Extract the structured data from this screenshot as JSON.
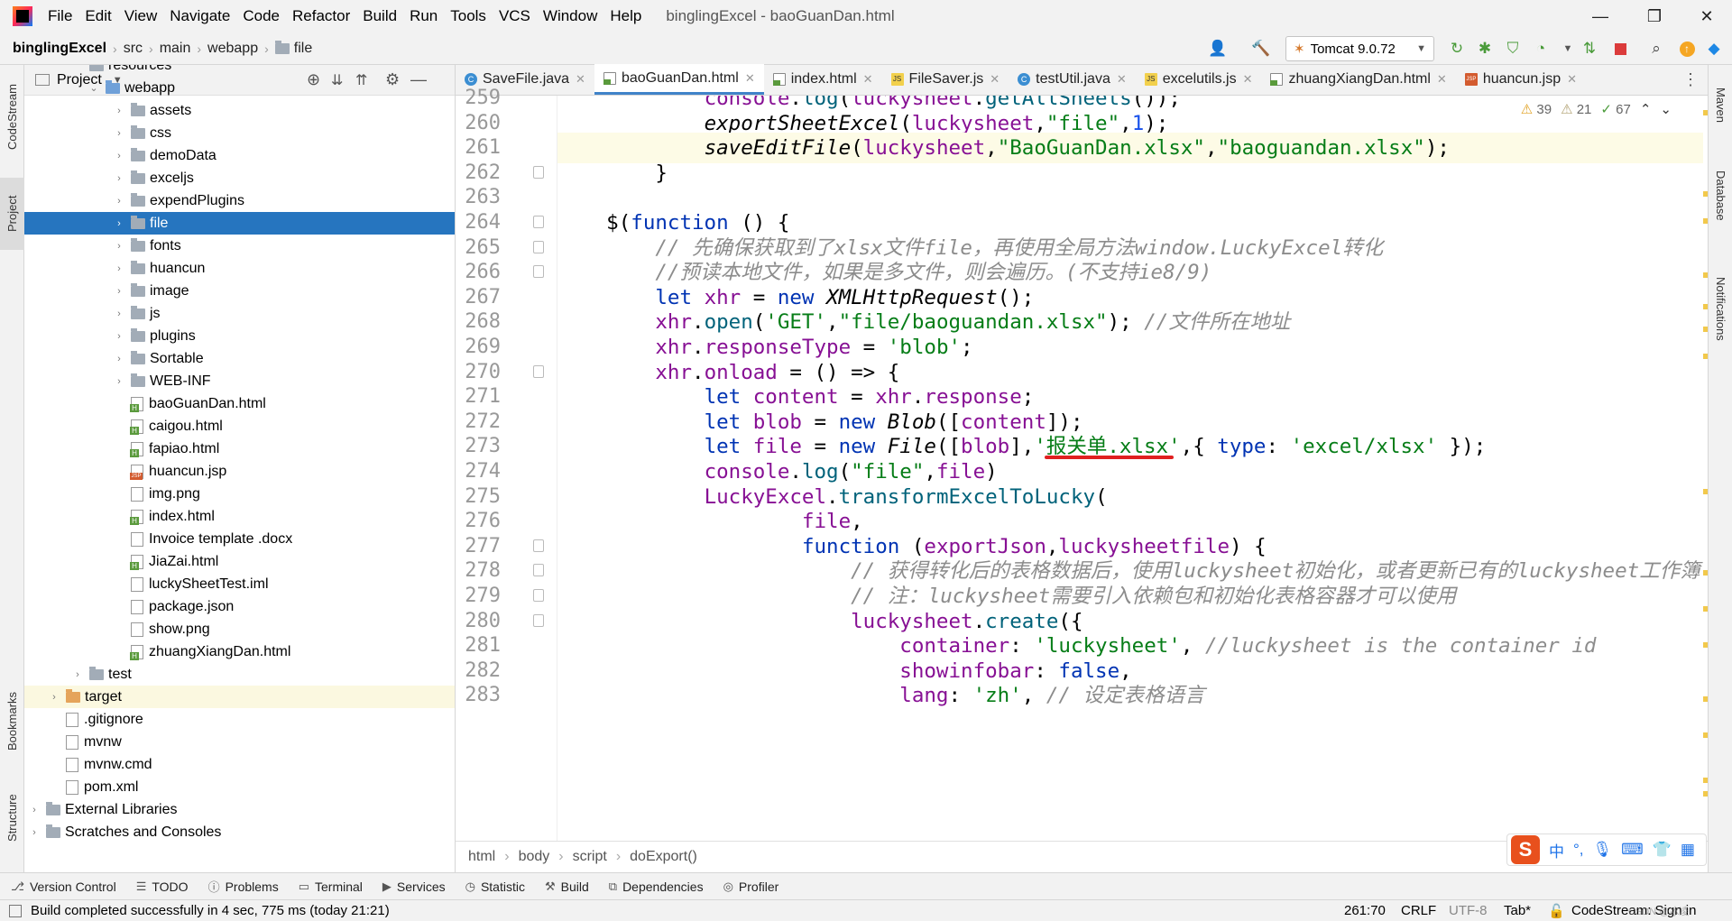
{
  "menubar": {
    "items": [
      "File",
      "Edit",
      "View",
      "Navigate",
      "Code",
      "Refactor",
      "Build",
      "Run",
      "Tools",
      "VCS",
      "Window",
      "Help"
    ],
    "title": "binglingExcel - baoGuanDan.html"
  },
  "navbar": {
    "project": "binglingExcel",
    "crumbs": [
      "src",
      "main",
      "webapp",
      "file"
    ]
  },
  "runconfig": {
    "label": "Tomcat 9.0.72"
  },
  "left_tools": {
    "codestream": "CodeStream",
    "project": "Project",
    "bookmarks": "Bookmarks",
    "structure": "Structure"
  },
  "right_tools": {
    "maven": "Maven",
    "database": "Database",
    "notifications": "Notifications"
  },
  "project_panel": {
    "title": "Project"
  },
  "tree": [
    {
      "label": "resources",
      "indent": 1,
      "arrow": "",
      "kind": "folder"
    },
    {
      "label": "webapp",
      "indent": 2,
      "arrow": "⌄",
      "kind": "folder-blue"
    },
    {
      "label": "assets",
      "indent": 3,
      "arrow": "›",
      "kind": "folder"
    },
    {
      "label": "css",
      "indent": 3,
      "arrow": "›",
      "kind": "folder"
    },
    {
      "label": "demoData",
      "indent": 3,
      "arrow": "›",
      "kind": "folder"
    },
    {
      "label": "exceljs",
      "indent": 3,
      "arrow": "›",
      "kind": "folder"
    },
    {
      "label": "expendPlugins",
      "indent": 3,
      "arrow": "›",
      "kind": "folder"
    },
    {
      "label": "file",
      "indent": 3,
      "arrow": "›",
      "kind": "folder",
      "selected": true
    },
    {
      "label": "fonts",
      "indent": 3,
      "arrow": "›",
      "kind": "folder"
    },
    {
      "label": "huancun",
      "indent": 3,
      "arrow": "›",
      "kind": "folder"
    },
    {
      "label": "image",
      "indent": 3,
      "arrow": "›",
      "kind": "folder"
    },
    {
      "label": "js",
      "indent": 3,
      "arrow": "›",
      "kind": "folder"
    },
    {
      "label": "plugins",
      "indent": 3,
      "arrow": "›",
      "kind": "folder"
    },
    {
      "label": "Sortable",
      "indent": 3,
      "arrow": "›",
      "kind": "folder"
    },
    {
      "label": "WEB-INF",
      "indent": 3,
      "arrow": "›",
      "kind": "folder"
    },
    {
      "label": "baoGuanDan.html",
      "indent": 3,
      "arrow": "",
      "kind": "html"
    },
    {
      "label": "caigou.html",
      "indent": 3,
      "arrow": "",
      "kind": "html"
    },
    {
      "label": "fapiao.html",
      "indent": 3,
      "arrow": "",
      "kind": "html"
    },
    {
      "label": "huancun.jsp",
      "indent": 3,
      "arrow": "",
      "kind": "jsp"
    },
    {
      "label": "img.png",
      "indent": 3,
      "arrow": "",
      "kind": "file"
    },
    {
      "label": "index.html",
      "indent": 3,
      "arrow": "",
      "kind": "html"
    },
    {
      "label": "Invoice template .docx",
      "indent": 3,
      "arrow": "",
      "kind": "file"
    },
    {
      "label": "JiaZai.html",
      "indent": 3,
      "arrow": "",
      "kind": "html"
    },
    {
      "label": "luckySheetTest.iml",
      "indent": 3,
      "arrow": "",
      "kind": "file"
    },
    {
      "label": "package.json",
      "indent": 3,
      "arrow": "",
      "kind": "file"
    },
    {
      "label": "show.png",
      "indent": 3,
      "arrow": "",
      "kind": "file"
    },
    {
      "label": "zhuangXiangDan.html",
      "indent": 3,
      "arrow": "",
      "kind": "html"
    },
    {
      "label": "test",
      "indent": 1,
      "arrow": "›",
      "kind": "folder"
    },
    {
      "label": "target",
      "indent": 0,
      "arrow": "›",
      "kind": "folder-orange",
      "highlight": true
    },
    {
      "label": ".gitignore",
      "indent": 0,
      "arrow": "",
      "kind": "file"
    },
    {
      "label": "mvnw",
      "indent": 0,
      "arrow": "",
      "kind": "file"
    },
    {
      "label": "mvnw.cmd",
      "indent": 0,
      "arrow": "",
      "kind": "file"
    },
    {
      "label": "pom.xml",
      "indent": 0,
      "arrow": "",
      "kind": "file"
    },
    {
      "label": "External Libraries",
      "indent": -1,
      "arrow": "›",
      "kind": "lib"
    },
    {
      "label": "Scratches and Consoles",
      "indent": -1,
      "arrow": "›",
      "kind": "lib"
    }
  ],
  "tabs": [
    {
      "label": "SaveFile.java",
      "icon": "c"
    },
    {
      "label": "baoGuanDan.html",
      "icon": "html",
      "active": true
    },
    {
      "label": "index.html",
      "icon": "html"
    },
    {
      "label": "FileSaver.js",
      "icon": "js"
    },
    {
      "label": "testUtil.java",
      "icon": "c"
    },
    {
      "label": "excelutils.js",
      "icon": "js"
    },
    {
      "label": "zhuangXiangDan.html",
      "icon": "html"
    },
    {
      "label": "huancun.jsp",
      "icon": "jsp"
    }
  ],
  "inspections": {
    "warnings": "39",
    "weak": "21",
    "typos": "67"
  },
  "line_numbers": [
    "259",
    "260",
    "261",
    "262",
    "263",
    "264",
    "265",
    "266",
    "267",
    "268",
    "269",
    "270",
    "271",
    "272",
    "273",
    "274",
    "275",
    "276",
    "277",
    "278",
    "279",
    "280",
    "281",
    "282",
    "283"
  ],
  "code_lines": [
    "            console.log(luckysheet.getAllSheets());",
    "            exportSheetExcel(luckysheet,\"file\",1);",
    "            saveEditFile(luckysheet,\"BaoGuanDan.xlsx\",\"baoguandan.xlsx\");",
    "        }",
    "",
    "    $(function () {",
    "        // 先确保获取到了xlsx文件file，再使用全局方法window.LuckyExcel转化",
    "        //预读本地文件，如果是多文件，则会遍历。(不支持ie8/9)",
    "        let xhr = new XMLHttpRequest();",
    "        xhr.open('GET',\"file/baoguandan.xlsx\"); //文件所在地址",
    "        xhr.responseType = 'blob';",
    "        xhr.onload = () => {",
    "            let content = xhr.response;",
    "            let blob = new Blob([content]);",
    "            let file = new File([blob],'报关单.xlsx',{ type: 'excel/xlsx' });",
    "            console.log(\"file\",file)",
    "            LuckyExcel.transformExcelToLucky(",
    "                    file,",
    "                    function (exportJson,luckysheetfile) {",
    "                        // 获得转化后的表格数据后，使用luckysheet初始化，或者更新已有的luckysheet工作簿",
    "                        // 注：luckysheet需要引入依赖包和初始化表格容器才可以使用",
    "                        luckysheet.create({",
    "                            container: 'luckysheet', //luckysheet is the container id",
    "                            showinfobar: false,",
    "                            lang: 'zh', // 设定表格语言"
  ],
  "breadcrumb": [
    "html",
    "body",
    "script",
    "doExport()"
  ],
  "bottom_tools": [
    "Version Control",
    "TODO",
    "Problems",
    "Terminal",
    "Services",
    "Statistic",
    "Build",
    "Dependencies",
    "Profiler"
  ],
  "status": {
    "message": "Build completed successfully in 4 sec, 775 ms (today 21:21)",
    "position": "261:70",
    "line_sep": "CRLF",
    "encoding": "UTF-8",
    "indent": "Tab*",
    "plugin": "CodeStream: Sign in",
    "watermark": "CSDN @冰凌"
  },
  "ime": {
    "brand": "S",
    "lang": "中"
  },
  "colors": {
    "selection": "#2675bf",
    "keyword": "#0033b3",
    "string": "#067d17",
    "comment": "#8c8c8c",
    "annotation": "#e02020"
  }
}
